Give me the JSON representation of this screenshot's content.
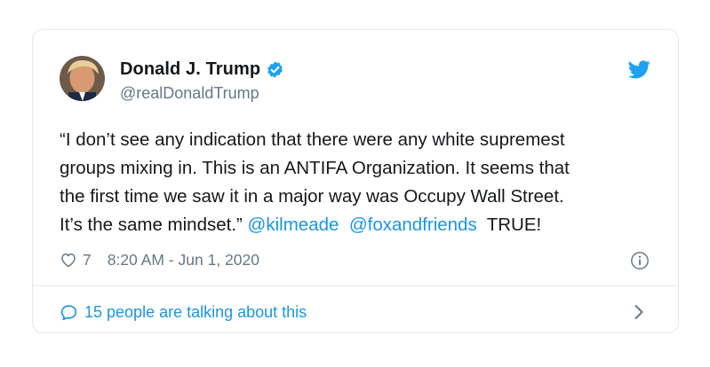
{
  "tweet": {
    "author": {
      "display_name": "Donald J. Trump",
      "handle": "@realDonaldTrump",
      "verified": true,
      "avatar_icon": "profile-photo"
    },
    "text_lines": [
      [
        "“I don’t see any indication that there were any white supremest"
      ],
      [
        "groups mixing in. This is an ANTIFA Organization. It seems that"
      ],
      [
        "the first time we saw it in a major way was Occupy Wall Street."
      ],
      [
        "It’s the same mindset.” ",
        "@kilmeade",
        "  ",
        "@foxandfriends",
        "  TRUE!"
      ]
    ],
    "likes": "7",
    "timestamp": "8:20 AM - Jun 1, 2020",
    "conversation_link": "15 people are talking about this"
  },
  "icons": {
    "brand": "twitter-bird-icon",
    "verified": "verified-badge-icon",
    "like": "heart-icon",
    "info": "info-icon",
    "reply": "speech-bubble-icon",
    "navigate": "chevron-right-icon"
  },
  "colors": {
    "accent": "#1b95e0",
    "verified_badge": "#1da1f2",
    "text_primary": "#14171a",
    "text_secondary": "#657786",
    "border": "#e1e8ed"
  }
}
